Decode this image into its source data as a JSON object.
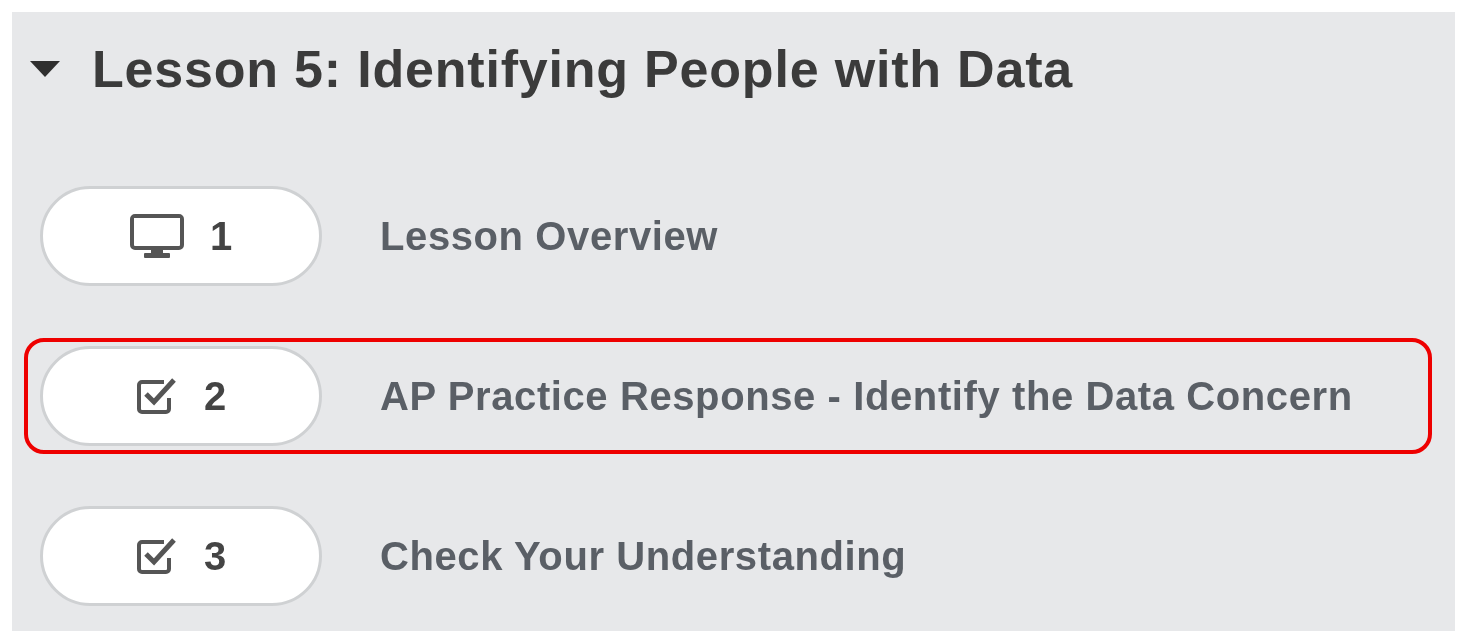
{
  "lesson": {
    "title": "Lesson 5: Identifying People with Data",
    "expanded": true,
    "items": [
      {
        "kind": "overview",
        "number": "1",
        "label": "Lesson Overview",
        "highlighted": false
      },
      {
        "kind": "assessment",
        "number": "2",
        "label": "AP Practice Response - Identify the Data Concern",
        "highlighted": true
      },
      {
        "kind": "assessment",
        "number": "3",
        "label": "Check Your Understanding",
        "highlighted": false
      }
    ]
  }
}
